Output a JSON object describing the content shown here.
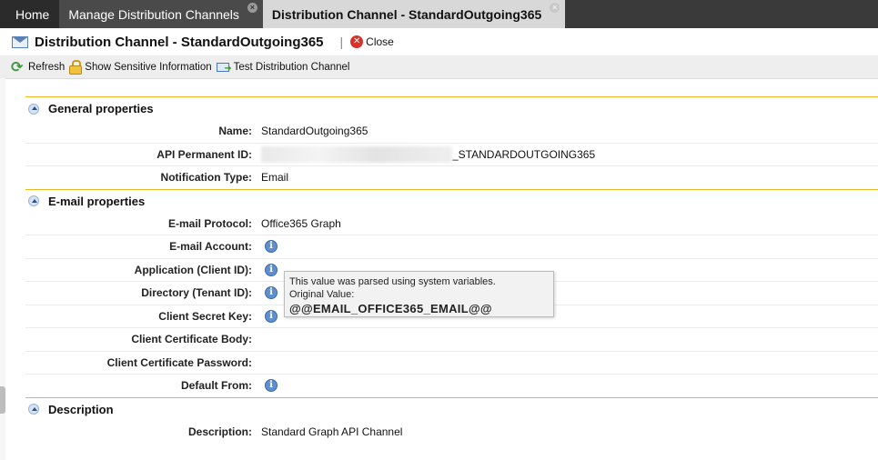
{
  "tabs": [
    {
      "label": "Home"
    },
    {
      "label": "Manage Distribution Channels",
      "close": "×"
    },
    {
      "label": "Distribution Channel - StandardOutgoing365",
      "close": "×"
    }
  ],
  "title": {
    "text": "Distribution Channel - StandardOutgoing365",
    "separator": "|",
    "close_label": "Close"
  },
  "toolbar": {
    "refresh": "Refresh",
    "show_sensitive": "Show Sensitive Information",
    "test_channel": "Test Distribution Channel"
  },
  "sections": {
    "general": {
      "title": "General properties",
      "name_label": "Name:",
      "name_value": "StandardOutgoing365",
      "api_label": "API Permanent ID:",
      "api_value": "_STANDARDOUTGOING365",
      "type_label": "Notification Type:",
      "type_value": "Email"
    },
    "email": {
      "title": "E-mail properties",
      "protocol_label": "E-mail Protocol:",
      "protocol_value": "Office365 Graph",
      "account_label": "E-mail Account:",
      "app_label": "Application (Client ID):",
      "dir_label": "Directory (Tenant ID):",
      "secret_label": "Client Secret Key:",
      "cert_body_label": "Client Certificate Body:",
      "cert_pw_label": "Client Certificate Password:",
      "default_from_label": "Default From:"
    },
    "description": {
      "title": "Description",
      "desc_label": "Description:",
      "desc_value": "Standard Graph API Channel"
    }
  },
  "tooltip": {
    "line1": "This value was parsed using system variables.",
    "line2": "Original Value:",
    "value": "@@EMAIL_OFFICE365_EMAIL@@"
  },
  "colors": {
    "tabbar": "#3a3a3a",
    "section_line": "#f0b429",
    "info_icon": "#5f8fcf",
    "close_icon": "#d9302a"
  }
}
